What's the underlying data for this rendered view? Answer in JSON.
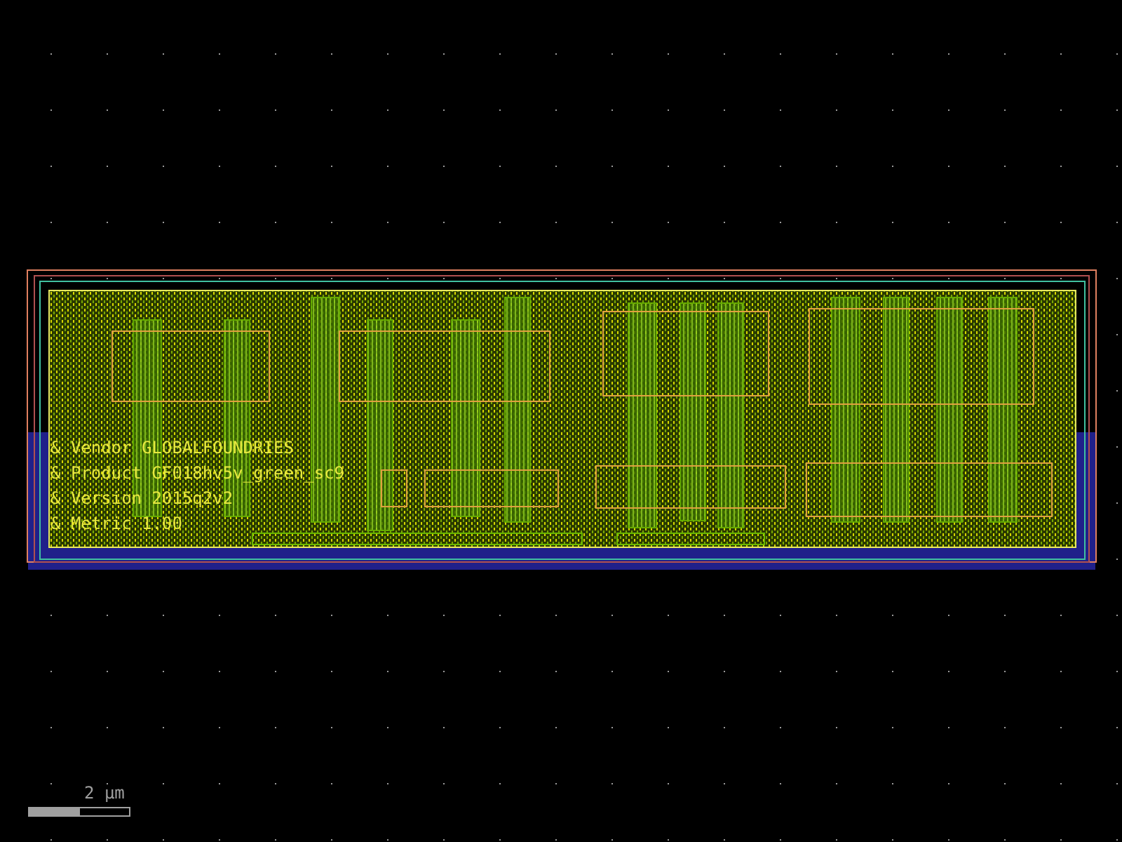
{
  "labels": [
    "& Vendor GLOBALFOUNDRIES",
    "& Product GF018hv5v_green_sc9",
    "& Version 2015q2v2",
    "& Metric 1.00"
  ],
  "scale_bar": {
    "label": "2 µm"
  }
}
